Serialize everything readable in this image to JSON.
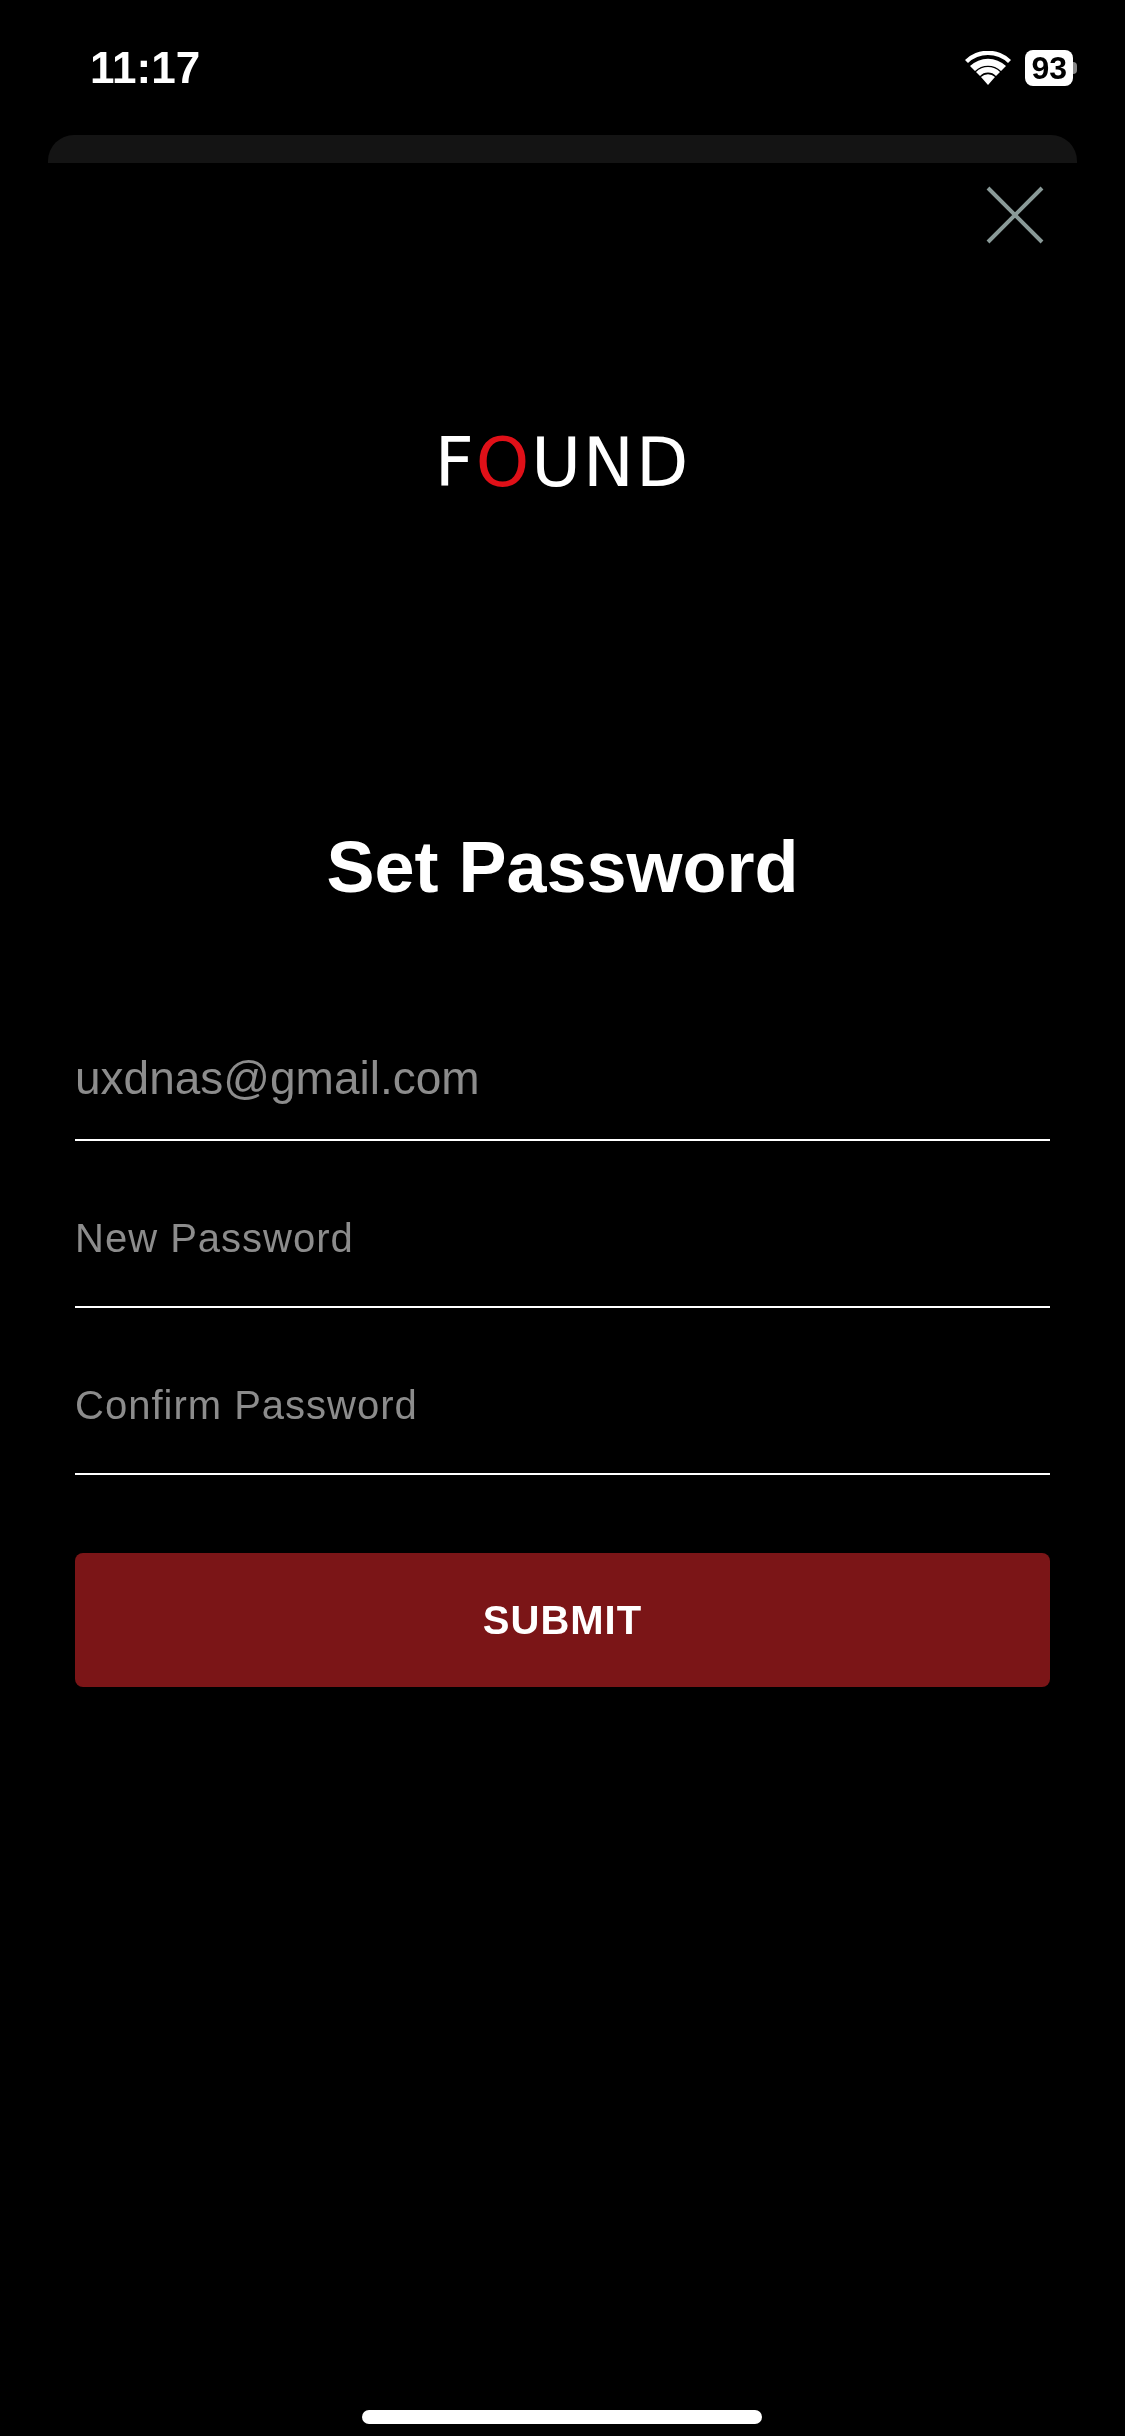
{
  "status_bar": {
    "time": "11:17",
    "battery": "93"
  },
  "logo": {
    "parts": [
      {
        "text": "F",
        "color": "#ffffff"
      },
      {
        "text": "O",
        "color": "#e01018"
      },
      {
        "text": "UND",
        "color": "#ffffff"
      }
    ]
  },
  "title": "Set Password",
  "fields": [
    {
      "value": "uxdnas@gmail.com",
      "disabled": true
    },
    {
      "placeholder": "New Password"
    },
    {
      "placeholder": "Confirm Password"
    }
  ],
  "submit_button": "SUBMIT"
}
